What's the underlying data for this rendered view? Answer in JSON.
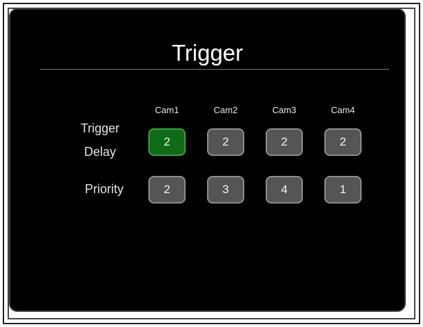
{
  "title": "Trigger",
  "columns": [
    "Cam1",
    "Cam2",
    "Cam3",
    "Cam4"
  ],
  "rows": {
    "trigger_delay": {
      "label_line1": "Trigger",
      "label_line2": "Delay",
      "values": [
        "2",
        "2",
        "2",
        "2"
      ]
    },
    "priority": {
      "label": "Priority",
      "values": [
        "2",
        "3",
        "4",
        "1"
      ]
    }
  },
  "selected_cell": "trigger_delay.Cam1",
  "colors": {
    "panel_bg": "#000000",
    "cell_bg": "#555555",
    "cell_border": "#8e8e8e",
    "selected_bg": "#0f6b17",
    "selected_border": "#3aa040",
    "text": "#ffffff"
  }
}
